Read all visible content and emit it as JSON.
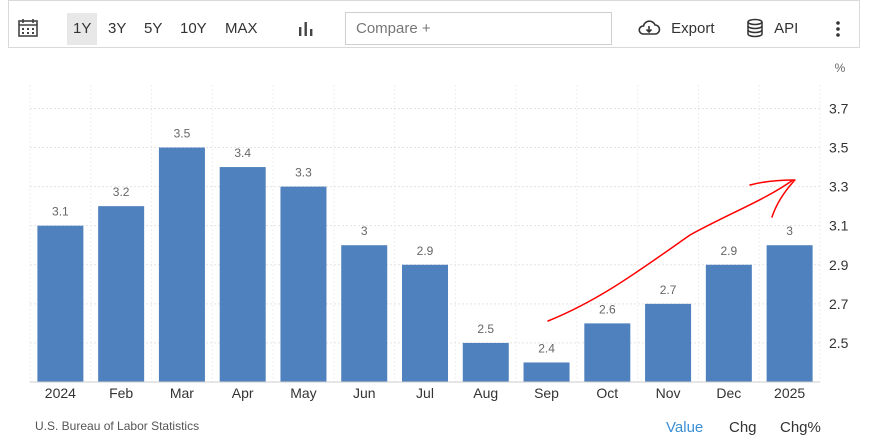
{
  "toolbar": {
    "calendar_icon": "calendar-icon",
    "ranges": [
      "1Y",
      "3Y",
      "5Y",
      "10Y",
      "MAX"
    ],
    "active_range": "1Y",
    "chart_type_icon": "bar-chart-icon",
    "compare_placeholder": "Compare +",
    "export_label": "Export",
    "export_icon": "cloud-download-icon",
    "api_label": "API",
    "api_icon": "database-icon",
    "more_icon": "vertical-ellipsis-icon"
  },
  "chart_data": {
    "type": "bar",
    "categories": [
      "2024",
      "Feb",
      "Mar",
      "Apr",
      "May",
      "Jun",
      "Jul",
      "Aug",
      "Sep",
      "Oct",
      "Nov",
      "Dec",
      "2025"
    ],
    "values": [
      3.1,
      3.2,
      3.5,
      3.4,
      3.3,
      3,
      2.9,
      2.5,
      2.4,
      2.6,
      2.7,
      2.9,
      3
    ],
    "data_labels": [
      "3.1",
      "3.2",
      "3.5",
      "3.4",
      "3.3",
      "3",
      "2.9",
      "2.5",
      "2.4",
      "2.6",
      "2.7",
      "2.9",
      "3"
    ],
    "y_unit": "%",
    "y_ticks": [
      2.5,
      2.7,
      2.9,
      3.1,
      3.3,
      3.5,
      3.7
    ],
    "y_tick_labels": [
      "2.5",
      "2.7",
      "2.9",
      "3.1",
      "3.3",
      "3.5",
      "3.7"
    ],
    "ylim": [
      2.3,
      3.82
    ],
    "grid": true,
    "bar_color": "#4e81bd",
    "annotation_color": "#ff0000"
  },
  "footer": {
    "source": "U.S. Bureau of Labor Statistics",
    "links": [
      "Value",
      "Chg",
      "Chg%"
    ],
    "active_link": "Value",
    "active_color": "#3b8fd4"
  }
}
